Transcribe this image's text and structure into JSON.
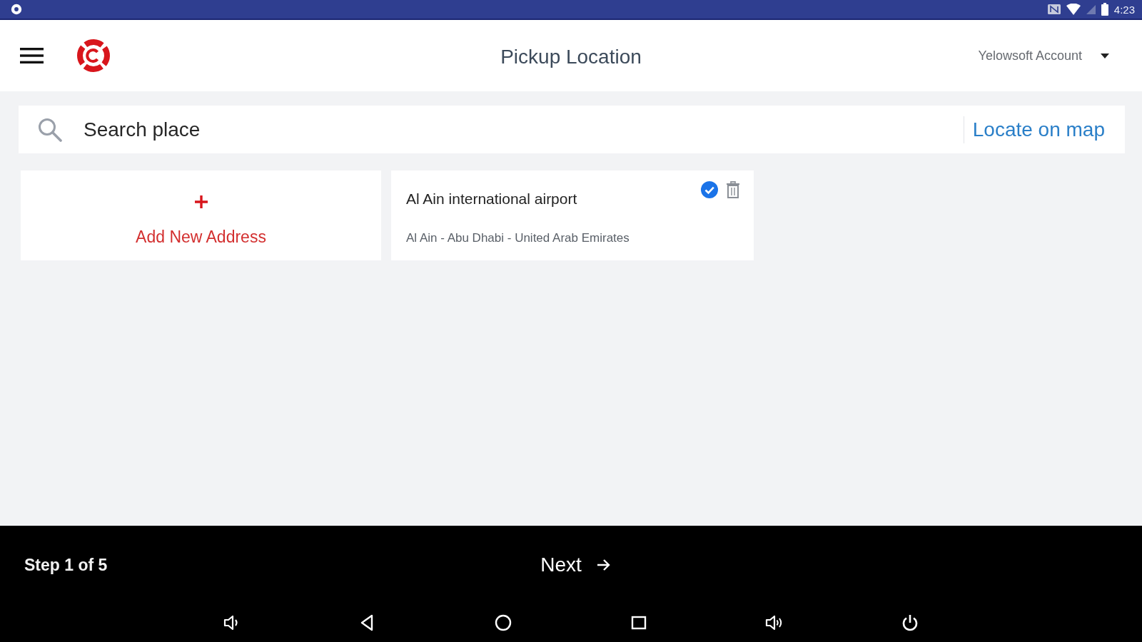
{
  "status_bar": {
    "time": "4:23"
  },
  "header": {
    "title": "Pickup Location",
    "account": "Yelowsoft Account"
  },
  "search": {
    "placeholder": "Search place",
    "action": "Locate on map"
  },
  "add_card": {
    "label": "Add New Address"
  },
  "addresses": [
    {
      "name": "Al Ain international airport",
      "detail": "Al Ain - Abu Dhabi - United Arab Emirates",
      "selected": true
    }
  ],
  "footer": {
    "step": "Step 1 of 5",
    "next": "Next"
  }
}
